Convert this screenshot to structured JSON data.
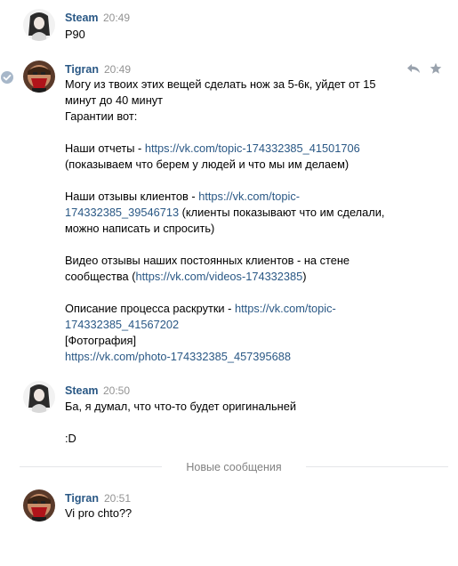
{
  "messages": [
    {
      "author": "Steam",
      "time": "20:49",
      "lines": [
        "P90"
      ]
    },
    {
      "author": "Tigran",
      "time": "20:49",
      "p1": "Могу из твоих этих вещей сделать нож за 5-6к, уйдет от 15 минут до 40 минут",
      "p2": "Гарантии вот:",
      "p3_text": "Наши отчеты - ",
      "p3_link": "https://vk.com/topic-174332385_41501706",
      "p3_tail": "(показываем что берем у людей и что мы им делаем)",
      "p4_text": "Наши отзывы клиентов - ",
      "p4_link_a": "https://vk.com/topic-",
      "p4_link_b": "174332385_39546713",
      "p4_tail": " (клиенты показывают что им сделали, можно написать и спросить)",
      "p5_text": "Видео отзывы наших постоянных клиентов - на стене сообщества (",
      "p5_link": "https://vk.com/videos-174332385",
      "p5_close": ")",
      "p6_text": "Описание процесса раскрутки - ",
      "p6_link_a": "https://vk.com/topic-",
      "p6_link_b": "174332385_41567202",
      "p7": "[Фотография]",
      "p8_link": "https://vk.com/photo-174332385_457395688"
    },
    {
      "author": "Steam",
      "time": "20:50",
      "line1": "Ба, я думал, что что-то будет оригинальней",
      "line2": ":D"
    },
    {
      "author": "Tigran",
      "time": "20:51",
      "line1": "Vi pro chto??"
    }
  ],
  "divider": "Новые сообщения",
  "icons": {
    "reply": "reply-icon",
    "star": "star-icon",
    "check": "check-icon"
  }
}
